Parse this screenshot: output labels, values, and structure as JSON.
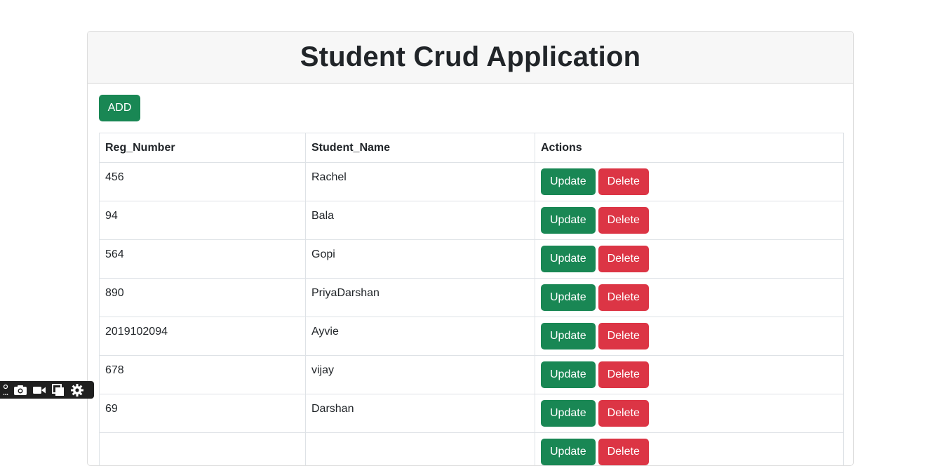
{
  "header": {
    "title": "Student Crud Application"
  },
  "toolbar": {
    "add_label": "ADD"
  },
  "table": {
    "columns": [
      "Reg_Number",
      "Student_Name",
      "Actions"
    ],
    "rows": [
      {
        "reg": "456",
        "name": "Rachel"
      },
      {
        "reg": "94",
        "name": "Bala"
      },
      {
        "reg": "564",
        "name": "Gopi"
      },
      {
        "reg": "890",
        "name": "PriyaDarshan"
      },
      {
        "reg": "2019102094",
        "name": "Ayvie"
      },
      {
        "reg": "678",
        "name": "vijay"
      },
      {
        "reg": "69",
        "name": "Darshan"
      },
      {
        "reg": "",
        "name": ""
      }
    ],
    "update_label": "Update",
    "delete_label": "Delete"
  },
  "colors": {
    "success": "#198754",
    "danger": "#dc3545",
    "header_bg": "#f7f7f7"
  },
  "floating_toolbar": {
    "icons": [
      "pin-icon",
      "camera-icon",
      "video-icon",
      "copy-icon",
      "gear-icon"
    ]
  }
}
